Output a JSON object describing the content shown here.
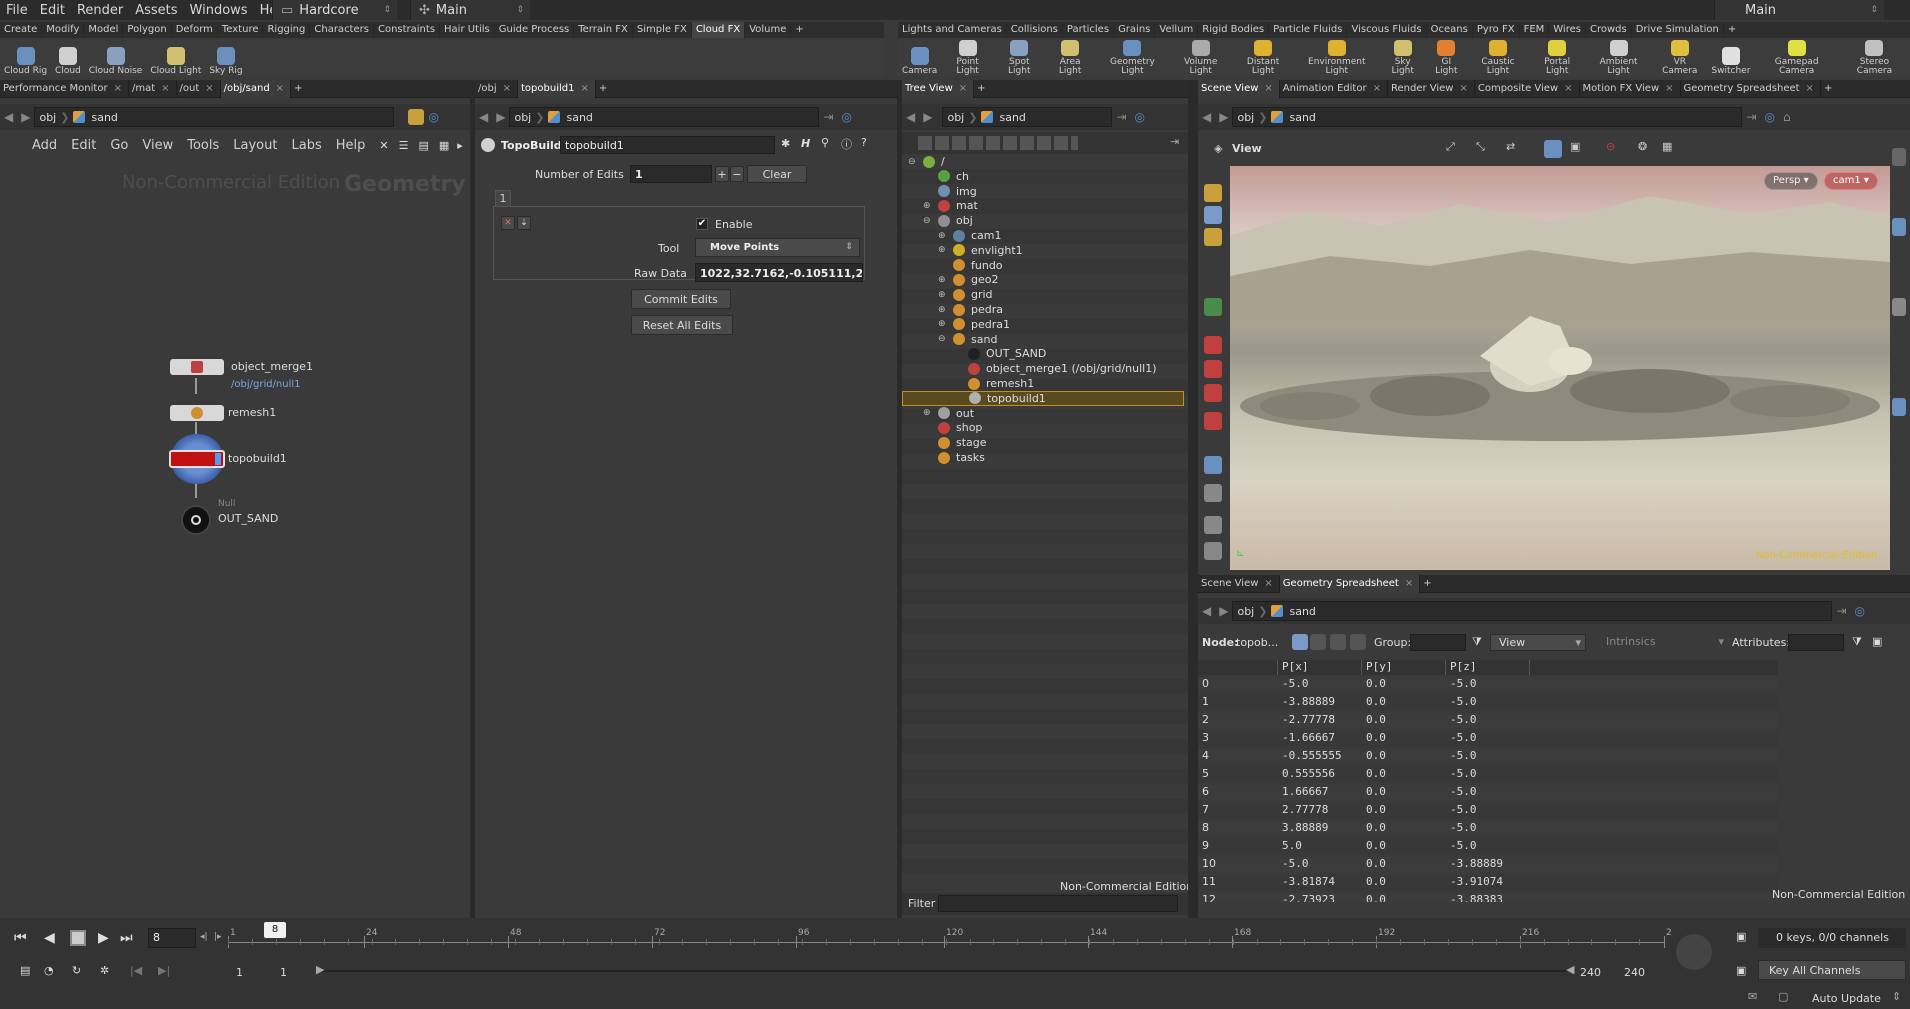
{
  "menu": [
    "File",
    "Edit",
    "Render",
    "Assets",
    "Windows",
    "Help"
  ],
  "desktop": "Hardcore",
  "context": "Main",
  "context_right": "Main",
  "shelf_left_tabs": [
    "Create",
    "Modify",
    "Model",
    "Polygon",
    "Deform",
    "Texture",
    "Rigging",
    "Characters",
    "Constraints",
    "Hair Utils",
    "Guide Process",
    "Terrain FX",
    "Simple FX",
    "Cloud FX",
    "Volume"
  ],
  "shelf_left_active": 13,
  "shelf_left_tools": [
    "Cloud Rig",
    "Cloud",
    "Cloud Noise",
    "Cloud Light",
    "Sky Rig"
  ],
  "shelf_right_tabs": [
    "Lights and Cameras",
    "Collisions",
    "Particles",
    "Grains",
    "Vellum",
    "Rigid Bodies",
    "Particle Fluids",
    "Viscous Fluids",
    "Oceans",
    "Pyro FX",
    "FEM",
    "Wires",
    "Crowds",
    "Drive Simulation"
  ],
  "shelf_right_tools": [
    "Camera",
    "Point Light",
    "Spot Light",
    "Area Light",
    "Geometry Light",
    "Volume Light",
    "Distant Light",
    "Environment Light",
    "Sky Light",
    "GI Light",
    "Caustic Light",
    "Portal Light",
    "Ambient Light",
    "VR Camera",
    "Switcher",
    "Gamepad Camera",
    "Stereo Camera"
  ],
  "net_pane": {
    "tabs": [
      "Performance Monitor",
      "/mat",
      "/out",
      "/obj/sand"
    ],
    "path": [
      "obj",
      "sand"
    ],
    "menu": [
      "Add",
      "Edit",
      "Go",
      "View",
      "Tools",
      "Layout",
      "Labs",
      "Help"
    ],
    "watermark": "Non-Commercial Edition",
    "context_label": "Geometry",
    "nodes": {
      "object_merge": "object_merge1",
      "object_merge_sub": "/obj/grid/null1",
      "remesh": "remesh1",
      "topobuild": "topobuild1",
      "null_type": "Null",
      "out": "OUT_SAND"
    }
  },
  "param_pane": {
    "tabs": [
      "/obj",
      "topobuild1"
    ],
    "path": [
      "obj",
      "sand"
    ],
    "node_type": "TopoBuild",
    "node_name": "topobuild1",
    "num_edits_label": "Number of Edits",
    "num_edits": "1",
    "clear": "Clear",
    "multiparm_index": "1",
    "enable_label": "Enable",
    "tool_label": "Tool",
    "tool_value": "Move Points",
    "raw_label": "Raw Data",
    "raw_value": "1022,32.7162,-0.105111,2.",
    "commit": "Commit Edits",
    "reset": "Reset All Edits"
  },
  "tree_pane": {
    "tab": "Tree View",
    "path": [
      "obj",
      "sand"
    ],
    "rows": [
      {
        "label": "/",
        "indent": 0,
        "exp": "-",
        "color": "#7ab040"
      },
      {
        "label": "ch",
        "indent": 1,
        "exp": "",
        "color": "#5aa040"
      },
      {
        "label": "img",
        "indent": 1,
        "exp": "",
        "color": "#7090b0"
      },
      {
        "label": "mat",
        "indent": 1,
        "exp": "+",
        "color": "#c04040"
      },
      {
        "label": "obj",
        "indent": 1,
        "exp": "-",
        "color": "#909090"
      },
      {
        "label": "cam1",
        "indent": 2,
        "exp": "+",
        "color": "#6080a0"
      },
      {
        "label": "envlight1",
        "indent": 2,
        "exp": "+",
        "color": "#d0b020"
      },
      {
        "label": "fundo",
        "indent": 2,
        "exp": "",
        "color": "#d09030"
      },
      {
        "label": "geo2",
        "indent": 2,
        "exp": "+",
        "color": "#d09030"
      },
      {
        "label": "grid",
        "indent": 2,
        "exp": "+",
        "color": "#d09030"
      },
      {
        "label": "pedra",
        "indent": 2,
        "exp": "+",
        "color": "#d09030"
      },
      {
        "label": "pedra1",
        "indent": 2,
        "exp": "+",
        "color": "#d09030"
      },
      {
        "label": "sand",
        "indent": 2,
        "exp": "-",
        "color": "#d09030"
      },
      {
        "label": "OUT_SAND",
        "indent": 3,
        "exp": "",
        "color": "#202020"
      },
      {
        "label": "object_merge1 (/obj/grid/null1)",
        "indent": 3,
        "exp": "",
        "color": "#c04040"
      },
      {
        "label": "remesh1",
        "indent": 3,
        "exp": "",
        "color": "#d09030"
      },
      {
        "label": "topobuild1",
        "indent": 3,
        "exp": "",
        "color": "#b0b0b0"
      },
      {
        "label": "out",
        "indent": 1,
        "exp": "+",
        "color": "#a0a0a0"
      },
      {
        "label": "shop",
        "indent": 1,
        "exp": "",
        "color": "#c04040"
      },
      {
        "label": "stage",
        "indent": 1,
        "exp": "",
        "color": "#d09030"
      },
      {
        "label": "tasks",
        "indent": 1,
        "exp": "",
        "color": "#d09030"
      }
    ],
    "selected_index": 16,
    "watermark": "Non-Commercial Edition",
    "filter_label": "Filter"
  },
  "viewport": {
    "tabs": [
      "Scene View",
      "Animation Editor",
      "Render View",
      "Composite View",
      "Motion FX View",
      "Geometry Spreadsheet"
    ],
    "path": [
      "obj",
      "sand"
    ],
    "view_label": "View",
    "persp": "Persp",
    "cam": "cam1",
    "watermark": "Non-Commercial Edition"
  },
  "spreadsheet": {
    "tabs": [
      "Scene View",
      "Geometry Spreadsheet"
    ],
    "path": [
      "obj",
      "sand"
    ],
    "node_label": "Node:",
    "node_value": "topob...",
    "group_label": "Group:",
    "view": "View",
    "intrinsics": "Intrinsics",
    "attributes_label": "Attributes:",
    "columns": [
      "",
      "P[x]",
      "P[y]",
      "P[z]"
    ],
    "rows": [
      [
        "0",
        "-5.0",
        "0.0",
        "-5.0"
      ],
      [
        "1",
        "-3.88889",
        "0.0",
        "-5.0"
      ],
      [
        "2",
        "-2.77778",
        "0.0",
        "-5.0"
      ],
      [
        "3",
        "-1.66667",
        "0.0",
        "-5.0"
      ],
      [
        "4",
        "-0.555555",
        "0.0",
        "-5.0"
      ],
      [
        "5",
        "0.555556",
        "0.0",
        "-5.0"
      ],
      [
        "6",
        "1.66667",
        "0.0",
        "-5.0"
      ],
      [
        "7",
        "2.77778",
        "0.0",
        "-5.0"
      ],
      [
        "8",
        "3.88889",
        "0.0",
        "-5.0"
      ],
      [
        "9",
        "5.0",
        "0.0",
        "-5.0"
      ],
      [
        "10",
        "-5.0",
        "0.0",
        "-3.88889"
      ],
      [
        "11",
        "-3.81874",
        "0.0",
        "-3.91074"
      ],
      [
        "12",
        "-2.73923",
        "0.0",
        "-3.88383"
      ]
    ],
    "watermark": "Non-Commercial Edition"
  },
  "timeline": {
    "frame": "8",
    "current_frame_marker": "8",
    "ticks": [
      "1",
      "24",
      "48",
      "72",
      "96",
      "120",
      "144",
      "168",
      "192",
      "216",
      "2"
    ],
    "range_start": "1",
    "range_start2": "1",
    "range_end": "240",
    "range_end2": "240",
    "keys_info": "0 keys, 0/0 channels",
    "key_all": "Key All Channels",
    "auto_update": "Auto Update"
  }
}
